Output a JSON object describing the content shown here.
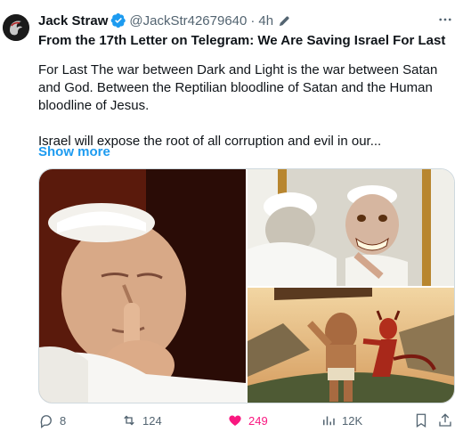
{
  "author": {
    "name": "Jack Straw",
    "handle": "@JackStr42679640",
    "separator": "·",
    "time": "4h"
  },
  "post": {
    "title": "From the 17th Letter on Telegram: We Are Saving Israel For Last",
    "paragraph1": "For Last The war between Dark and Light is the war between Satan and God. Between the Reptilian bloodline of Satan and the Human bloodline of Jesus.",
    "paragraph2": "Israel will expose the root of all corruption and evil in our...",
    "show_more": "Show more"
  },
  "media": {
    "images": [
      {
        "icon": "photo-pope-praying"
      },
      {
        "icon": "photo-pope-mirror-reflection"
      },
      {
        "icon": "photo-painting-figure-fighting-devil"
      }
    ]
  },
  "actions": {
    "replies": "8",
    "reposts": "124",
    "likes": "249",
    "views": "12K"
  },
  "colors": {
    "accent": "#1d9bf0",
    "like": "#f91880",
    "secondary_text": "#536471",
    "verified": "#1d9bf0"
  }
}
